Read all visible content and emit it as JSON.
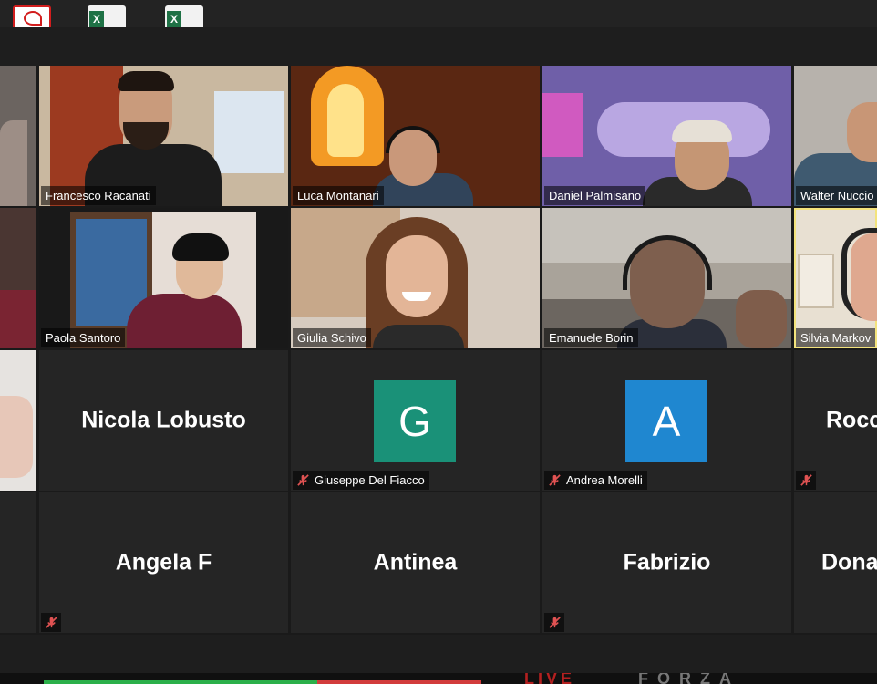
{
  "desktop": {
    "icons": [
      "pdf-file-icon",
      "excel-file-icon",
      "excel-file-icon"
    ],
    "bottom_banner": {
      "left_text": "LIVE",
      "right_text": "FORZA"
    }
  },
  "meeting": {
    "colors": {
      "active_speaker_border": "#f3e37c",
      "avatar_green": "#1a9178",
      "avatar_blue": "#1f87d0"
    },
    "video_tiles": [
      {
        "name": "Francesco Racanati",
        "muted": false
      },
      {
        "name": "Luca Montanari",
        "muted": false
      },
      {
        "name": "Daniel Palmisano",
        "muted": false
      },
      {
        "name": "Walter Nuccio",
        "muted": false
      },
      {
        "name": "Paola Santoro",
        "muted": false
      },
      {
        "name": "Giulia Schivo",
        "muted": false
      },
      {
        "name": "Emanuele Borin",
        "muted": false
      },
      {
        "name": "Silvia Markov",
        "muted": false,
        "active": true
      }
    ],
    "name_tiles_row3": {
      "nicola": {
        "big_name": "Nicola Lobusto"
      },
      "giuseppe": {
        "avatar_letter": "G",
        "name": "Giuseppe Del Fiacco",
        "muted": true
      },
      "andrea": {
        "avatar_letter": "A",
        "name": "Andrea Morelli",
        "muted": true
      },
      "rocco": {
        "big_name": "Rocc",
        "muted": true
      }
    },
    "name_tiles_row4": {
      "angela": {
        "big_name": "Angela F",
        "muted": true
      },
      "antinea": {
        "big_name": "Antinea"
      },
      "fabrizio": {
        "big_name": "Fabrizio",
        "muted": true
      },
      "dona": {
        "big_name": "Dona"
      }
    }
  }
}
